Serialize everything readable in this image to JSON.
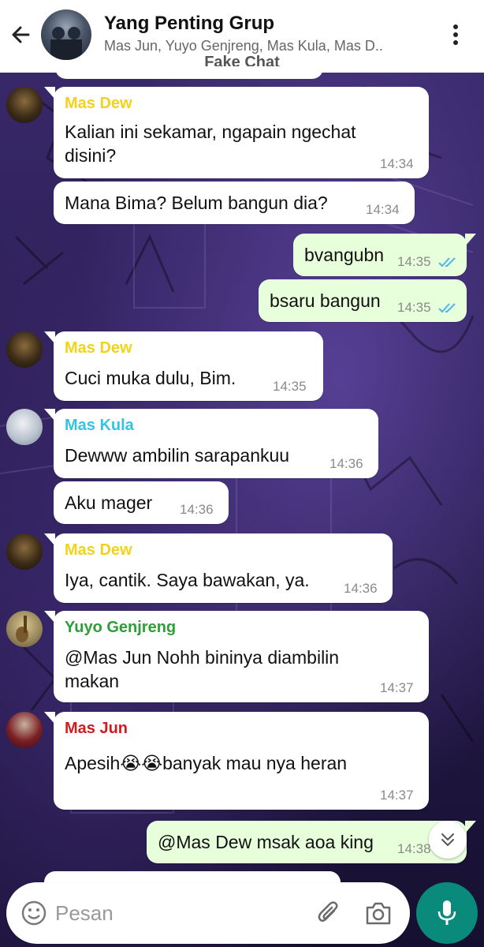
{
  "header": {
    "title": "Yang Penting Grup",
    "subtitle": "Mas Jun, Yuyo Genjreng, Mas Kula, Mas D..",
    "label": "Fake Chat"
  },
  "colors": {
    "outgoing_bubble": "#e7ffdb",
    "incoming_bubble": "#ffffff",
    "read_ticks": "#4fb6ec",
    "mic_button": "#0a8a7a",
    "sender_mas_dew": "#f2d21a",
    "sender_mas_kula": "#35c4e0",
    "sender_yuyo": "#2e9e3a",
    "sender_mas_jun": "#d41b1b"
  },
  "messages": [
    {
      "sender": "Mas Dew",
      "text_line1": "Kalian ini sekamar, ngapain ngechat",
      "text_line2": "disini?",
      "time": "14:34"
    },
    {
      "text": "Mana Bima? Belum bangun dia?",
      "time": "14:34"
    },
    {
      "text": "bvangubn",
      "time": "14:35",
      "status": "read"
    },
    {
      "text": "bsaru bangun",
      "time": "14:35",
      "status": "read"
    },
    {
      "sender": "Mas Dew",
      "text": "Cuci muka dulu, Bim.",
      "time": "14:35"
    },
    {
      "sender": "Mas Kula",
      "text": "Dewww ambilin sarapankuu",
      "time": "14:36"
    },
    {
      "text": "Aku mager",
      "time": "14:36"
    },
    {
      "sender": "Mas Dew",
      "text": "Iya, cantik. Saya bawakan, ya.",
      "time": "14:36"
    },
    {
      "sender": "Yuyo Genjreng",
      "text_line1": "@Mas Jun Nohh bininya diambilin",
      "text_line2": "makan",
      "time": "14:37"
    },
    {
      "sender": "Mas Jun",
      "text": "Apesih😭😭banyak mau nya heran",
      "time": "14:37"
    },
    {
      "text": "@Mas Dew msak aoa king",
      "time": "14:38"
    }
  ],
  "composer": {
    "placeholder": "Pesan"
  },
  "icons": {
    "back": "arrow-left",
    "menu": "vertical-dots",
    "emoji": "smiley",
    "attach": "paperclip",
    "camera": "camera",
    "mic": "microphone",
    "scroll": "double-chevron-down"
  }
}
